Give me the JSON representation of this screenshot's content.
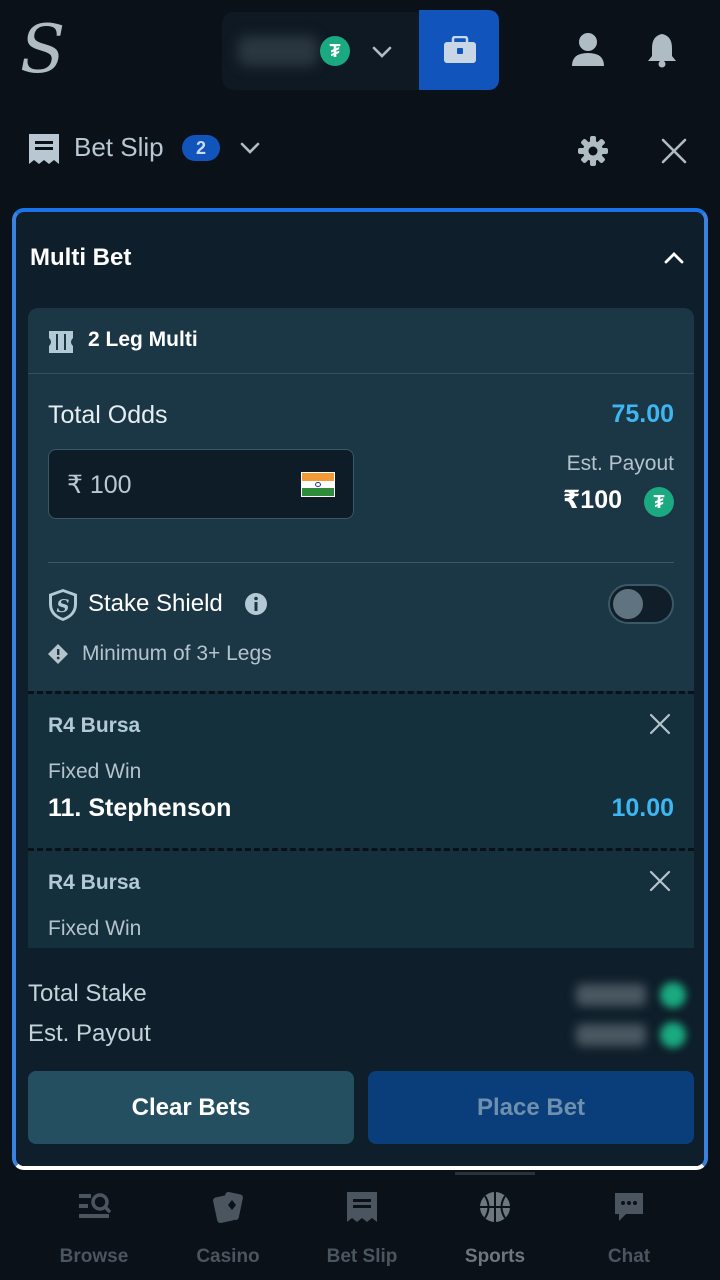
{
  "header": {
    "logo_letter": "S",
    "currency_coin": "₮"
  },
  "betslip": {
    "title": "Bet Slip",
    "count": "2"
  },
  "multi": {
    "title": "Multi Bet",
    "leg_title": "2 Leg Multi",
    "total_odds_label": "Total Odds",
    "total_odds_value": "75.00",
    "stake_placeholder": "₹ 100",
    "stake_value": "₹ 100",
    "est_payout_label": "Est. Payout",
    "est_payout_value": "₹100",
    "shield_label": "Stake Shield",
    "min_legs_label": "Minimum of 3+ Legs"
  },
  "legs": [
    {
      "race": "R4 Bursa",
      "type": "Fixed Win",
      "runner": "11. Stephenson",
      "odds": "10.00"
    },
    {
      "race": "R4 Bursa",
      "type": "Fixed Win",
      "runner": "",
      "odds": ""
    }
  ],
  "totals": {
    "total_stake_label": "Total Stake",
    "est_payout_label": "Est. Payout"
  },
  "actions": {
    "clear_label": "Clear Bets",
    "place_label": "Place Bet"
  },
  "nav": {
    "items": [
      {
        "label": "Browse"
      },
      {
        "label": "Casino"
      },
      {
        "label": "Bet Slip"
      },
      {
        "label": "Sports"
      },
      {
        "label": "Chat"
      }
    ]
  },
  "colors": {
    "accent": "#3db6f2",
    "brand_blue": "#1054bc",
    "tether": "#1aa980"
  }
}
